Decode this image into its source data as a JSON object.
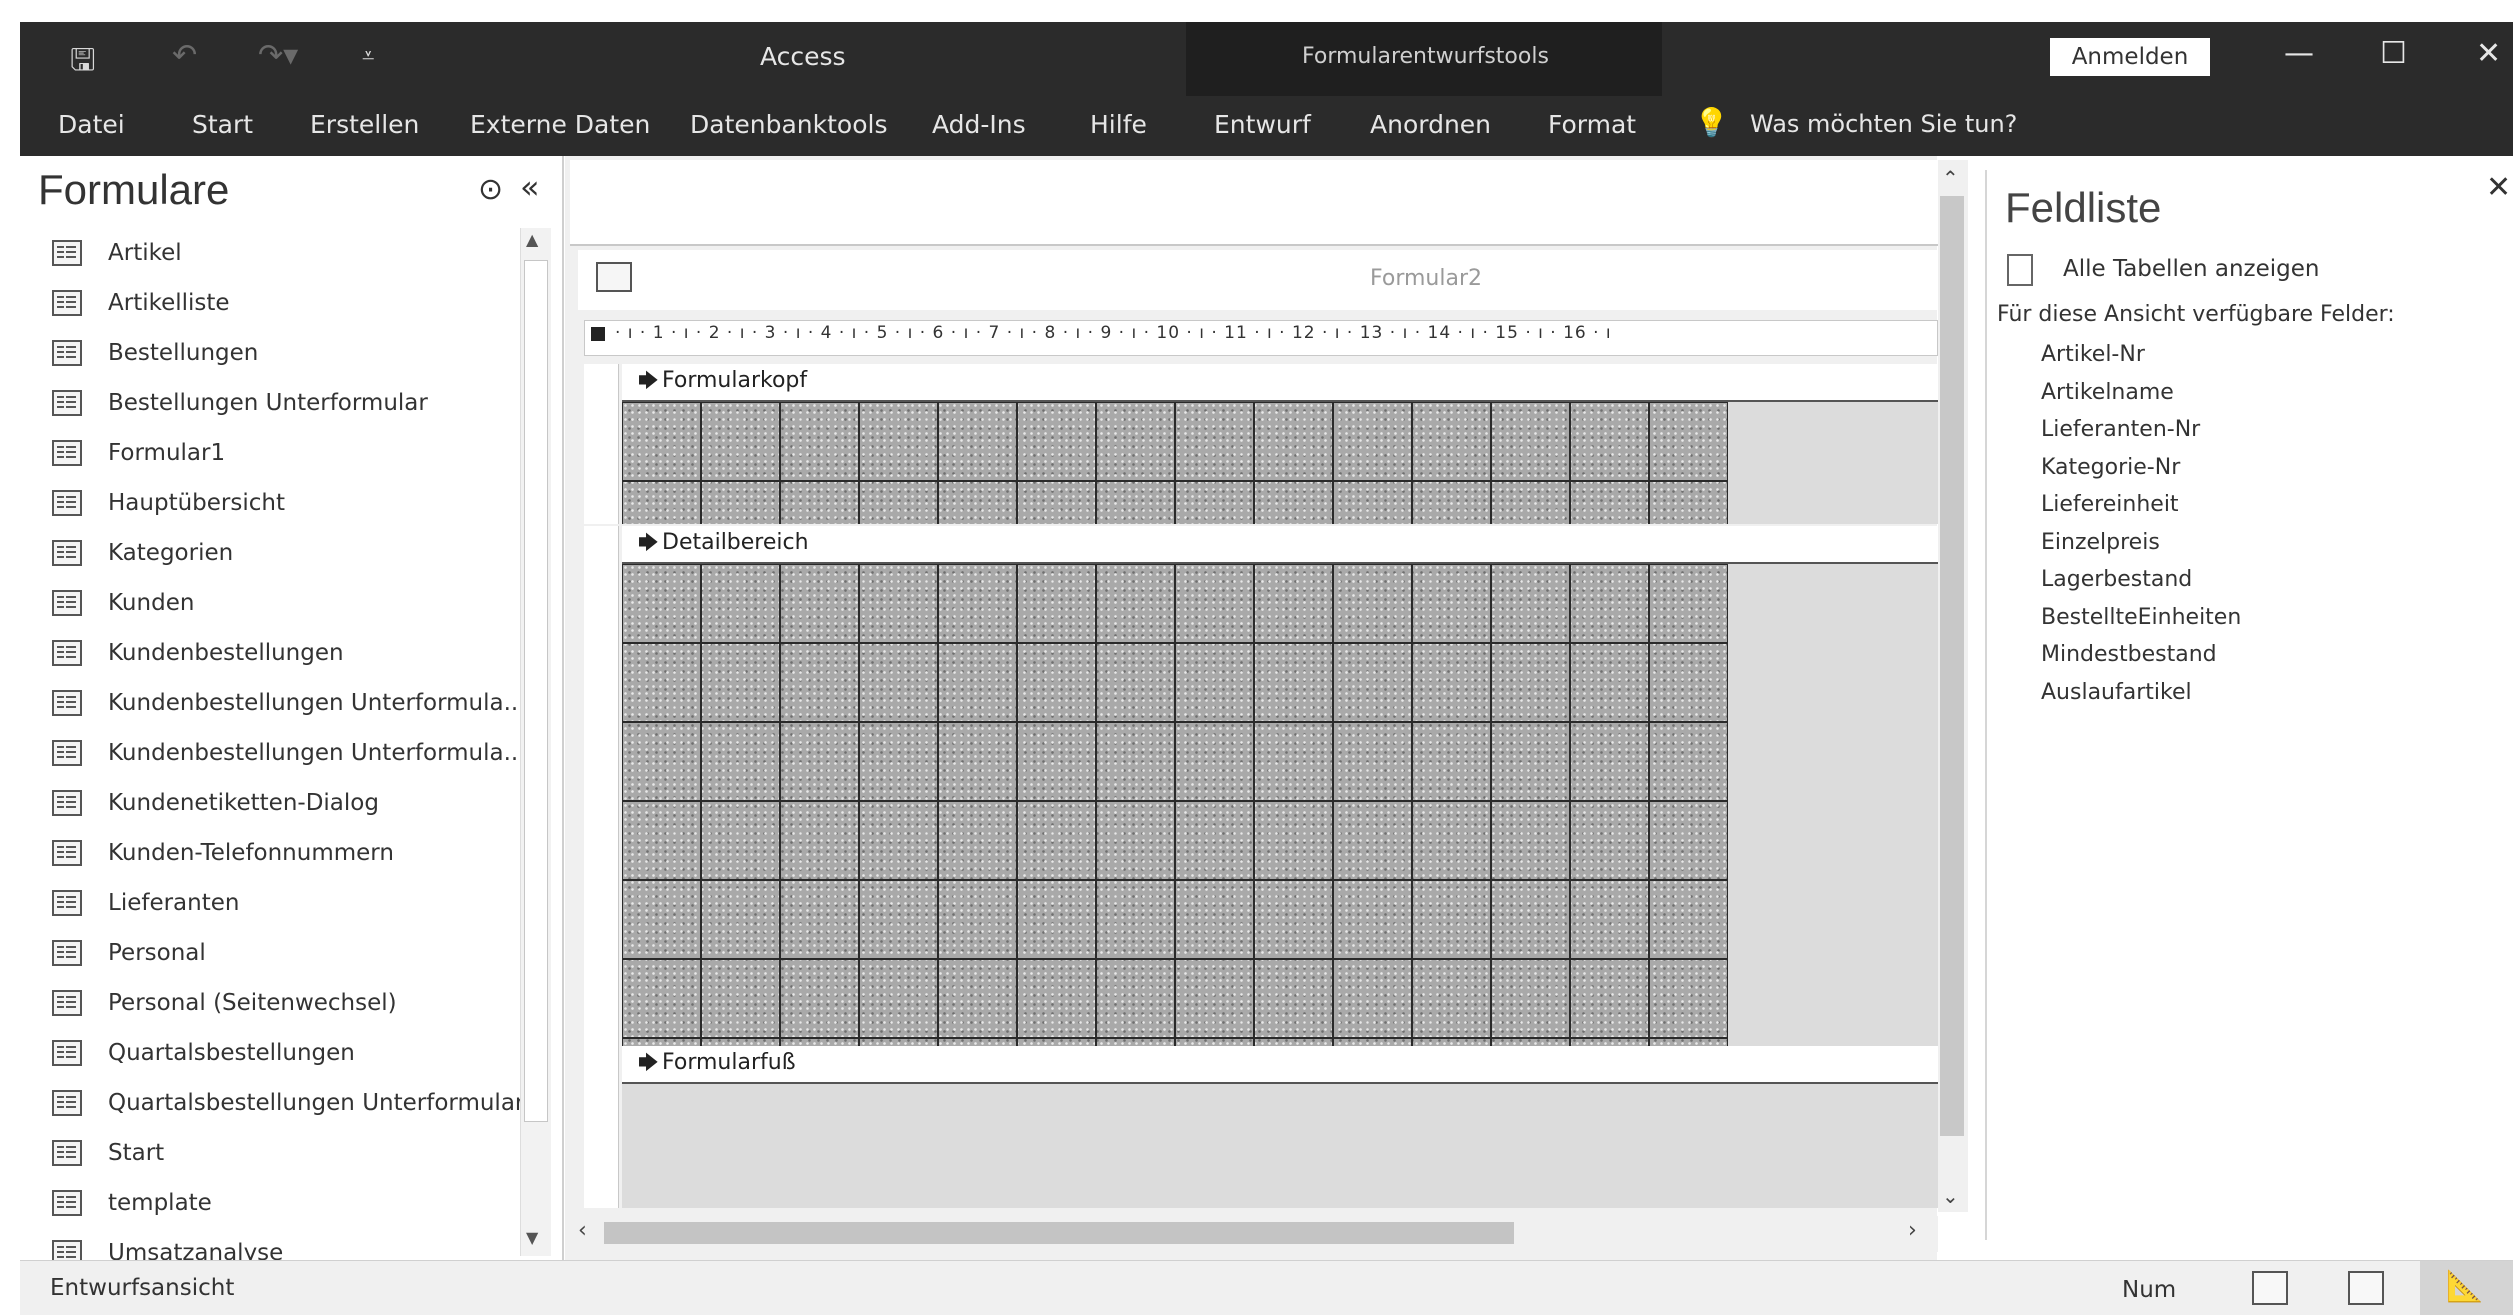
{
  "app": {
    "title": "Access",
    "context_title": "Formularentwurfstools",
    "signin_label": "Anmelden"
  },
  "qat": {
    "save_icon": "save-icon",
    "undo_icon": "undo-icon",
    "redo_icon": "redo-icon",
    "customize_icon": "customize-qat-icon"
  },
  "ribbon": {
    "tabs": [
      "Datei",
      "Start",
      "Erstellen",
      "Externe Daten",
      "Datenbanktools",
      "Add-Ins",
      "Hilfe",
      "Entwurf",
      "Anordnen",
      "Format"
    ],
    "tell_me": "Was möchten Sie tun?"
  },
  "nav": {
    "title": "Formulare",
    "items": [
      "Artikel",
      "Artikelliste",
      "Bestellungen",
      "Bestellungen Unterformular",
      "Formular1",
      "Hauptübersicht",
      "Kategorien",
      "Kunden",
      "Kundenbestellungen",
      "Kundenbestellungen Unterformula...",
      "Kundenbestellungen Unterformula...",
      "Kundenetiketten-Dialog",
      "Kunden-Telefonnummern",
      "Lieferanten",
      "Personal",
      "Personal (Seitenwechsel)",
      "Quartalsbestellungen",
      "Quartalsbestellungen Unterformular",
      "Start",
      "template",
      "Umsatzanalyse"
    ]
  },
  "form": {
    "name": "Formular2",
    "ruler": "· ı · 1 · ı · 2 · ı · 3 · ı · 4 · ı · 5 · ı · 6 · ı · 7 · ı · 8 · ı · 9 · ı · 10 · ı · 11 · ı · 12 · ı · 13 · ı · 14 · ı · 15 · ı · 16 · ı",
    "sections": {
      "header": "Formularkopf",
      "detail": "Detailbereich",
      "footer": "Formularfuß"
    }
  },
  "fieldlist": {
    "title": "Feldliste",
    "show_all": "Alle Tabellen anzeigen",
    "available": "Für diese Ansicht verfügbare Felder:",
    "fields": [
      "Artikel-Nr",
      "Artikelname",
      "Lieferanten-Nr",
      "Kategorie-Nr",
      "Liefereinheit",
      "Einzelpreis",
      "Lagerbestand",
      "BestellteEinheiten",
      "Mindestbestand",
      "Auslaufartikel"
    ]
  },
  "status": {
    "view": "Entwurfsansicht",
    "num": "Num"
  }
}
